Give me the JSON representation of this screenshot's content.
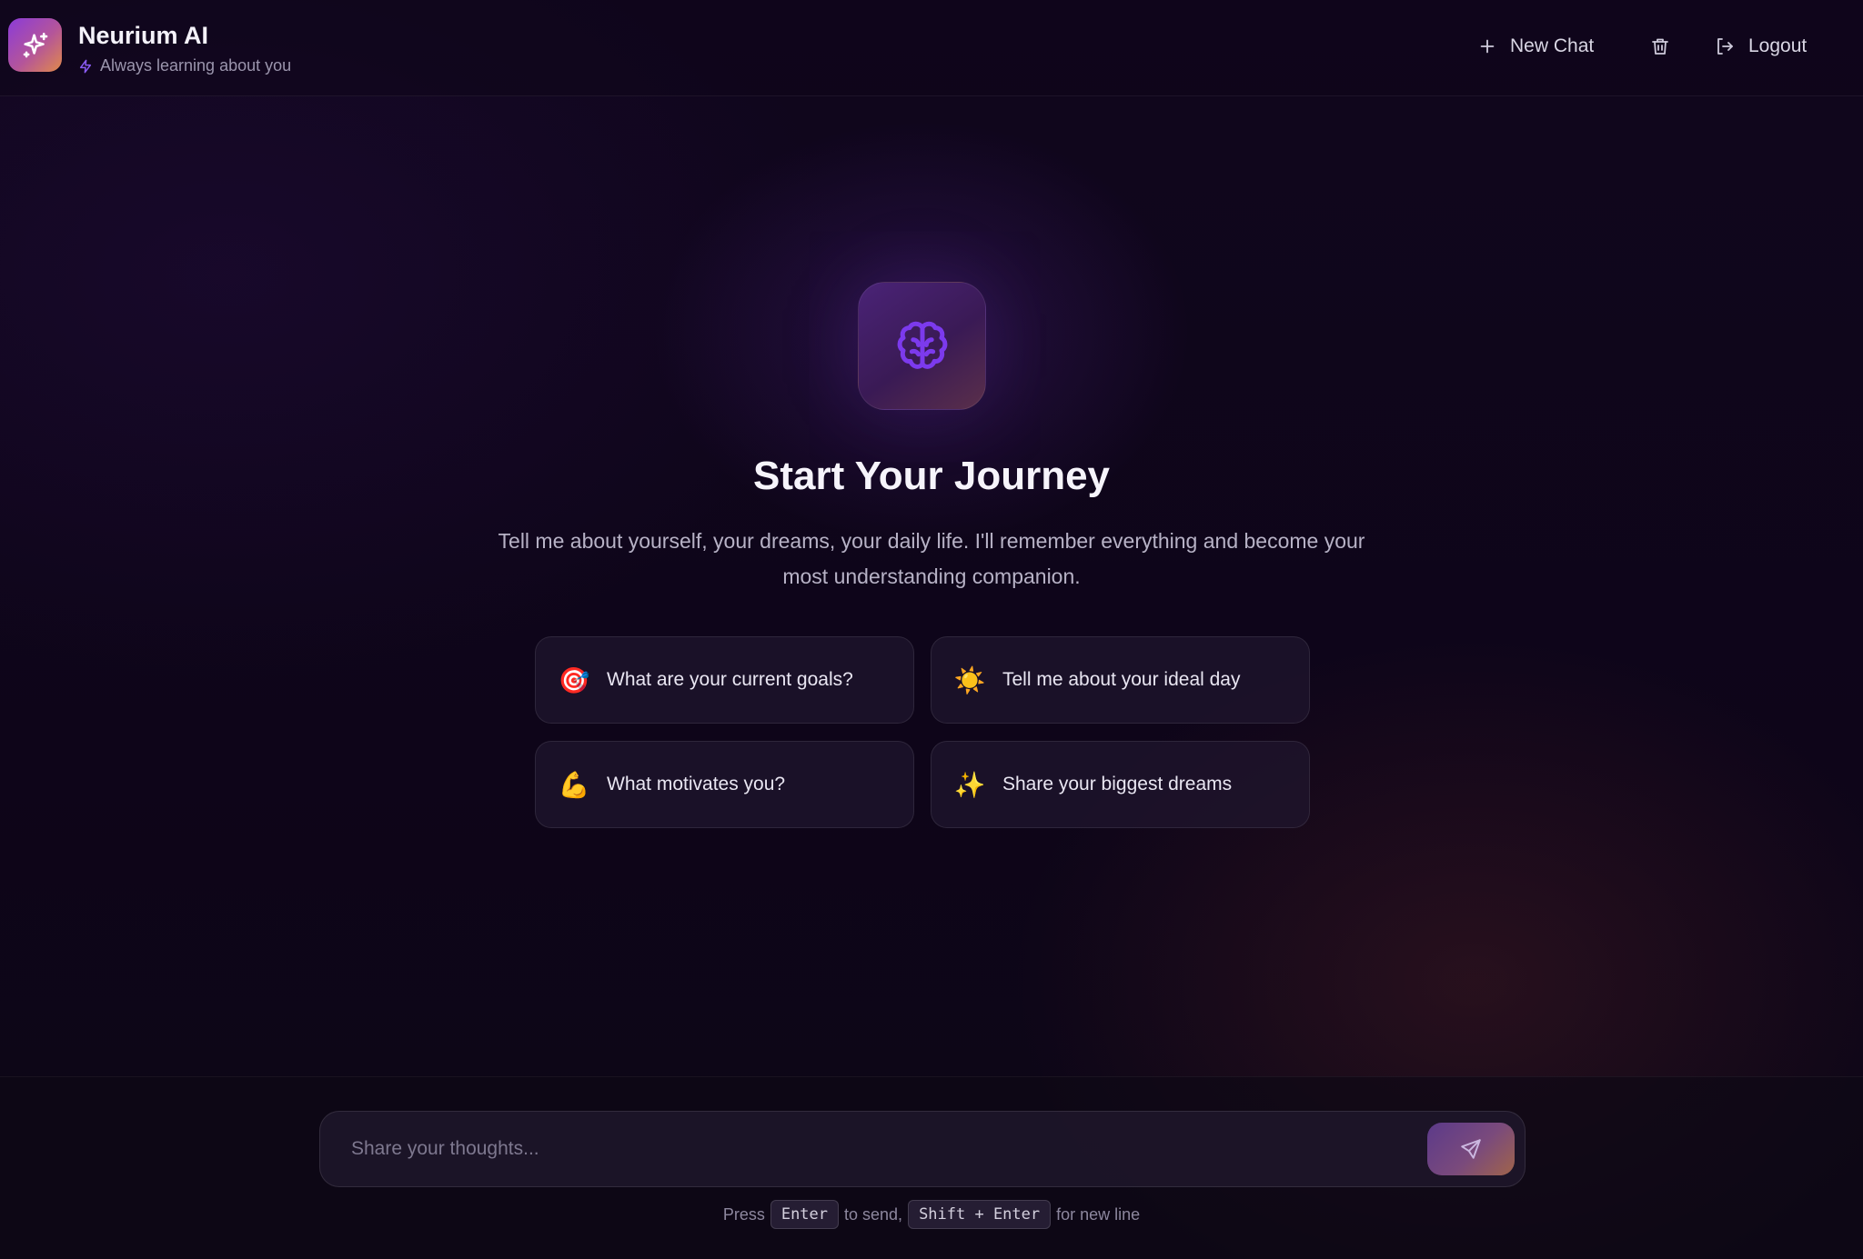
{
  "header": {
    "brand_title": "Neurium AI",
    "brand_subtitle": "Always learning about you",
    "new_chat_label": "New Chat",
    "logout_label": "Logout"
  },
  "hero": {
    "title": "Start Your Journey",
    "description": "Tell me about yourself, your dreams, your daily life. I'll remember everything and become your most understanding companion."
  },
  "suggestions": [
    {
      "emoji": "🎯",
      "label": "What are your current goals?"
    },
    {
      "emoji": "☀️",
      "label": "Tell me about your ideal day"
    },
    {
      "emoji": "💪",
      "label": "What motivates you?"
    },
    {
      "emoji": "✨",
      "label": "Share your biggest dreams"
    }
  ],
  "composer": {
    "placeholder": "Share your thoughts...",
    "hint_press": "Press",
    "hint_enter": "Enter",
    "hint_to_send": "to send,",
    "hint_shift_enter": "Shift + Enter",
    "hint_new_line": "for new line"
  },
  "colors": {
    "background": "#0c0517",
    "accent_purple": "#7c3aed",
    "accent_orange": "#e08a4a"
  },
  "icons": {
    "logo": "sparkles-icon",
    "subtitle": "zap-icon",
    "new_chat": "plus-icon",
    "delete": "trash-icon",
    "logout": "logout-icon",
    "hero": "brain-icon",
    "send": "send-icon"
  }
}
